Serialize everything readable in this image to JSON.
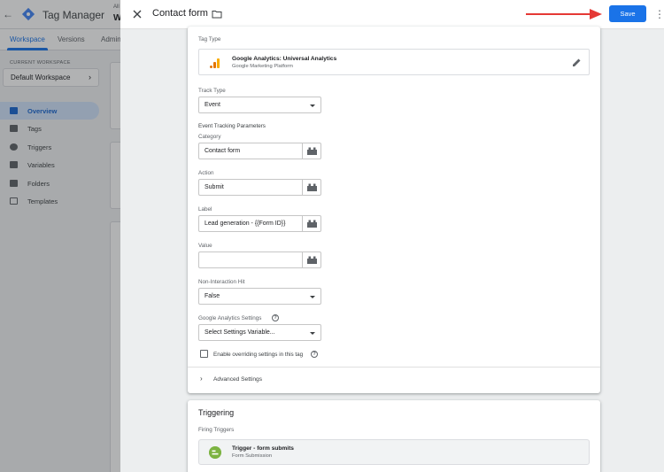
{
  "background": {
    "app_title": "Tag Manager",
    "account_small": "All",
    "account_name": "W",
    "tabs": [
      {
        "label": "Workspace",
        "active": true
      },
      {
        "label": "Versions",
        "active": false
      },
      {
        "label": "Admin",
        "active": false
      }
    ],
    "current_workspace_label": "CURRENT WORKSPACE",
    "workspace_name": "Default Workspace",
    "nav": [
      {
        "label": "Overview",
        "icon": "overview-icon",
        "active": true
      },
      {
        "label": "Tags",
        "icon": "tag-icon",
        "active": false
      },
      {
        "label": "Triggers",
        "icon": "trigger-icon",
        "active": false
      },
      {
        "label": "Variables",
        "icon": "variables-icon",
        "active": false
      },
      {
        "label": "Folders",
        "icon": "folder-icon",
        "active": false
      },
      {
        "label": "Templates",
        "icon": "templates-icon",
        "active": false
      }
    ]
  },
  "panel": {
    "title": "Contact form",
    "save_label": "Save",
    "more_glyph": "⋮",
    "close_icon": "close-icon"
  },
  "config": {
    "tag_type_label": "Tag Type",
    "tag_type_name": "Google Analytics: Universal Analytics",
    "tag_type_sub": "Google Marketing Platform",
    "track_type_label": "Track Type",
    "track_type_value": "Event",
    "event_params_label": "Event Tracking Parameters",
    "fields": [
      {
        "label": "Category",
        "value": "Contact form"
      },
      {
        "label": "Action",
        "value": "Submit"
      },
      {
        "label": "Label",
        "value": "Lead generation - {{Form ID}}"
      },
      {
        "label": "Value",
        "value": ""
      }
    ],
    "non_interaction_label": "Non-Interaction Hit",
    "non_interaction_value": "False",
    "ga_settings_label": "Google Analytics Settings",
    "ga_settings_value": "Select Settings Variable...",
    "override_label": "Enable overriding settings in this tag",
    "advanced_label": "Advanced Settings"
  },
  "triggering": {
    "title": "Triggering",
    "firing_label": "Firing Triggers",
    "trigger_name": "Trigger - form submits",
    "trigger_type": "Form Submission"
  },
  "colors": {
    "primary": "#1a73e8",
    "arrow": "#e53935",
    "ga_orange": "#f9ab00",
    "trigger_green": "#7cb342"
  }
}
